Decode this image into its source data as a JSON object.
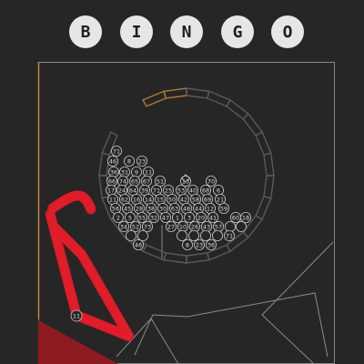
{
  "title": {
    "letters": [
      "B",
      "I",
      "N",
      "G",
      "O"
    ]
  },
  "colors": {
    "background": "#262626",
    "frame": "#8a8a8a",
    "frame_accent": "#c8813a",
    "drum": "#5a5a5a",
    "drum_highlight": "#b07a38",
    "ball_fill": "#262626",
    "ball_stroke": "#c8c8c8",
    "chute": "#e01e2a",
    "chute_dark": "#8e1a22",
    "title_bg": "#e6e6e6",
    "title_text": "#1e1e1e"
  },
  "drum": {
    "segments": 24,
    "highlighted_segments": 2
  },
  "balls": [
    {
      "label": "71"
    },
    {
      "label": "46"
    },
    {
      "label": "8"
    },
    {
      "label": "23"
    },
    {
      "label": "36"
    },
    {
      "label": "31"
    },
    {
      "label": "9"
    },
    {
      "label": "11"
    },
    {
      "label": "66"
    },
    {
      "label": "74"
    },
    {
      "label": "65"
    },
    {
      "label": "67"
    },
    {
      "label": "51"
    },
    {
      "label": "13"
    },
    {
      "label": "70"
    },
    {
      "label": "17"
    },
    {
      "label": "24"
    },
    {
      "label": "64"
    },
    {
      "label": "39"
    },
    {
      "label": "71"
    },
    {
      "label": "25"
    },
    {
      "label": "53"
    },
    {
      "label": "40"
    },
    {
      "label": "68"
    },
    {
      "label": "6"
    },
    {
      "label": "11"
    },
    {
      "label": "62"
    },
    {
      "label": "16"
    },
    {
      "label": "14"
    },
    {
      "label": "15"
    },
    {
      "label": "50"
    },
    {
      "label": "42"
    },
    {
      "label": "58"
    },
    {
      "label": "69"
    },
    {
      "label": "21"
    },
    {
      "label": "56"
    },
    {
      "label": "45"
    },
    {
      "label": "28"
    },
    {
      "label": "38"
    },
    {
      "label": "30"
    },
    {
      "label": "63"
    },
    {
      "label": "48"
    },
    {
      "label": "44"
    },
    {
      "label": "12"
    },
    {
      "label": "59"
    },
    {
      "label": "2"
    },
    {
      "label": "5"
    },
    {
      "label": "55"
    },
    {
      "label": "32"
    },
    {
      "label": "47"
    },
    {
      "label": "1"
    },
    {
      "label": "3"
    },
    {
      "label": "20"
    },
    {
      "label": "41"
    },
    {
      "label": "60"
    },
    {
      "label": "18"
    },
    {
      "label": "34"
    },
    {
      "label": "52"
    },
    {
      "label": "73"
    },
    {
      "label": "27"
    },
    {
      "label": "10"
    },
    {
      "label": "26"
    },
    {
      "label": "43"
    },
    {
      "label": "57"
    },
    {
      "label": ""
    },
    {
      "label": ""
    },
    {
      "label": ""
    },
    {
      "label": ""
    },
    {
      "label": ""
    },
    {
      "label": ""
    },
    {
      "label": ""
    },
    {
      "label": ""
    }
  ],
  "drawn_ball": {
    "label": "11"
  }
}
